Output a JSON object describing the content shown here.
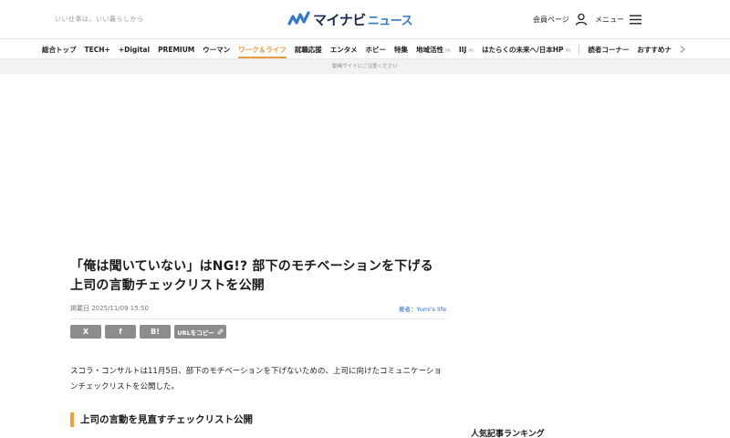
{
  "header": {
    "tagline": "いい仕事は、いい暮らしから",
    "logo_main": "マイナビ",
    "logo_sub": "ニュース",
    "member_label": "会員ページ",
    "menu_label": "メニュー"
  },
  "nav": {
    "items": [
      {
        "label": "総合トップ"
      },
      {
        "label": "TECH+"
      },
      {
        "label": "+Digital"
      },
      {
        "label": "PREMIUM"
      },
      {
        "label": "ウーマン"
      },
      {
        "label": "ワーク＆ライフ",
        "active": true
      },
      {
        "label": "就職応援"
      },
      {
        "label": "エンタメ"
      },
      {
        "label": "ホビー"
      },
      {
        "label": "特集"
      },
      {
        "label": "地域活性",
        "pr": "PR"
      },
      {
        "label": "IIJ",
        "pr": "PR"
      },
      {
        "label": "はたらくの未来へ/日本HP",
        "pr": "PR"
      },
      {
        "label": "読者コーナー"
      },
      {
        "label": "おすすめナ"
      }
    ]
  },
  "ad_note": "動画サイトにご注意ください",
  "article": {
    "title": "「俺は聞いていない」はNG!? 部下のモチベーションを下げる上司の言動チェックリストを公開",
    "date": "掲載日 2025/11/09 15:50",
    "author": "著者：Yumi's life",
    "share": {
      "x": "X",
      "facebook": "f",
      "hatena": "B!",
      "url_copy": "URLをコピー"
    },
    "lead": "スコラ・コンサルトは11月5日、部下のモチベーションを下げないための、上司に向けたコミュニケーションチェックリストを公開した。",
    "heading": "上司の言動を見直すチェックリスト公開"
  },
  "sidebar": {
    "ranking_title": "人気記事ランキング"
  },
  "colors": {
    "accent": "#e89a3c",
    "link": "#2e6ec0",
    "share_button": "#8c8c8c"
  }
}
